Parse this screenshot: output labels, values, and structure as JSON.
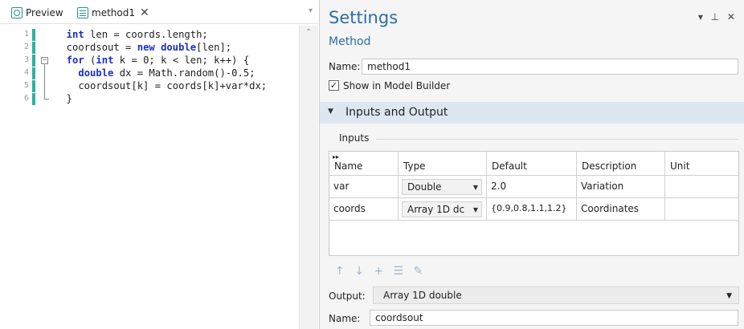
{
  "tabs": [
    {
      "label": "Preview",
      "icon": "preview-icon",
      "closable": false
    },
    {
      "label": "method1",
      "icon": "method-icon",
      "closable": true,
      "close_glyph": "✕"
    }
  ],
  "editor": {
    "lines": [
      {
        "n": "1",
        "code": "  int len = coords.length;"
      },
      {
        "n": "2",
        "code": "  coordsout = new double[len];"
      },
      {
        "n": "3",
        "code": "  for (int k = 0; k < len; k++) {"
      },
      {
        "n": "4",
        "code": "    double dx = Math.random()-0.5;"
      },
      {
        "n": "5",
        "code": "    coordsout[k] = coords[k]+var*dx;"
      },
      {
        "n": "6",
        "code": "  }"
      }
    ],
    "fold_glyph": "−",
    "accent": "#2fb29c",
    "keyword_color": "#1d2fbf"
  },
  "settings": {
    "title": "Settings",
    "subtitle": "Method",
    "header_icons": "▾ ⊥ ✕",
    "name_label": "Name:",
    "name_value": "method1",
    "show_checked_glyph": "✓",
    "show_label": "Show in Model Builder",
    "section_label": "Inputs and Output",
    "section_glyph": "▼",
    "inputs_title": "Inputs",
    "table": {
      "headers": [
        "Name",
        "Type",
        "Default",
        "Description",
        "Unit"
      ],
      "expand_glyph": "▸▸",
      "rows": [
        {
          "name": "var",
          "type": "Double",
          "default": "2.0",
          "description": "Variation",
          "unit": ""
        },
        {
          "name": "coords",
          "type": "Array 1D dc",
          "default": "{0.9,0.8,1.1,1.2}",
          "description": "Coordinates",
          "unit": ""
        }
      ]
    },
    "toolbar": {
      "up": "↑",
      "down": "↓",
      "add": "+",
      "delete": "☰",
      "edit": "✎"
    },
    "output_label": "Output:",
    "output_value": "Array 1D double",
    "output_name_label": "Name:",
    "output_name_value": "coordsout"
  },
  "colors": {
    "title": "#2a6fa6",
    "section_bg": "#dde7f1"
  }
}
